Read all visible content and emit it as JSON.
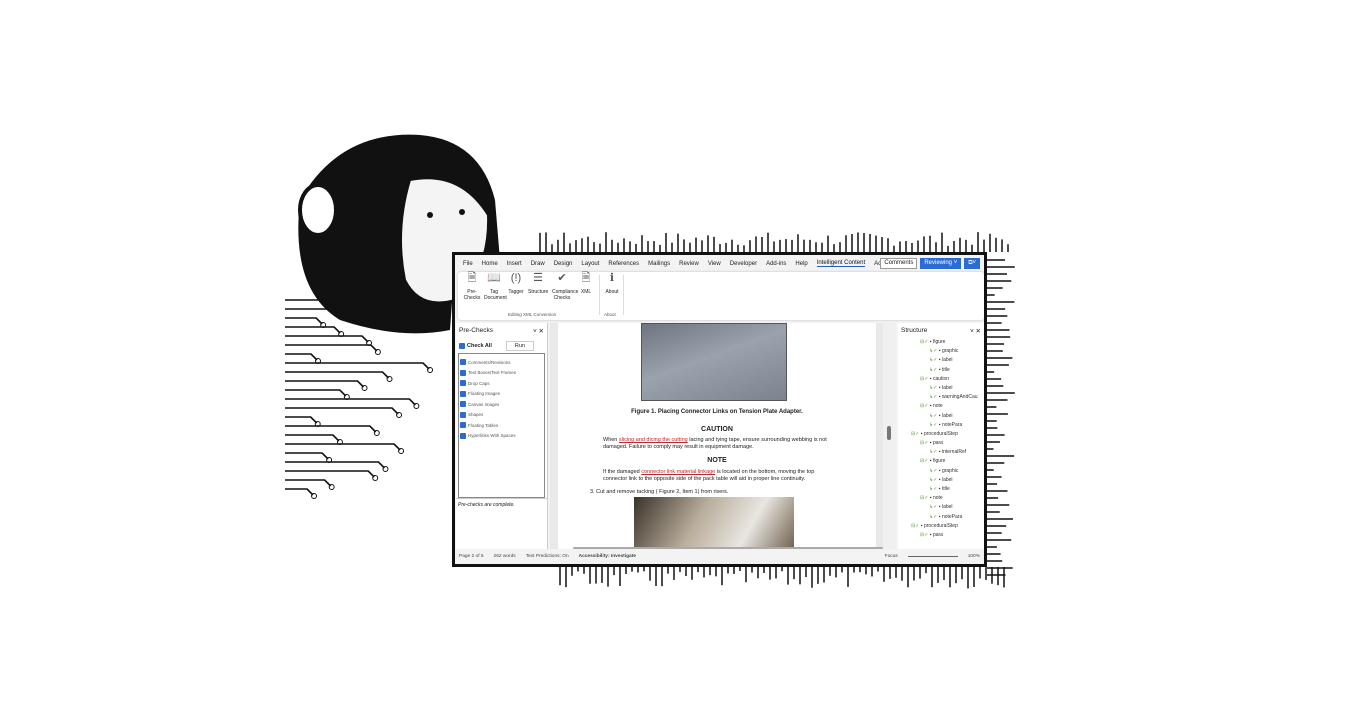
{
  "ribbon_tabs": [
    "File",
    "Home",
    "Insert",
    "Draw",
    "Design",
    "Layout",
    "References",
    "Mailings",
    "Review",
    "View",
    "Developer",
    "Add-ins",
    "Help",
    "Intelligent Content",
    "Acrobat"
  ],
  "active_tab": "Intelligent Content",
  "top_buttons": {
    "comments": "Comments",
    "reviewing": "Reviewing ˅",
    "share": "⧉˅"
  },
  "ribbon": {
    "buttons": [
      {
        "label": "Pre-Checks",
        "icon": "document-search-icon",
        "glyph": "🗎"
      },
      {
        "label": "Tag Document",
        "icon": "book-icon",
        "glyph": "📖"
      },
      {
        "label": "Tagger",
        "icon": "tag-icon",
        "glyph": "(!)"
      },
      {
        "label": "Structure",
        "icon": "structure-icon",
        "glyph": "☰"
      },
      {
        "label": "Compliance Checks",
        "icon": "checkmark-icon",
        "glyph": "✔"
      },
      {
        "label": "XML",
        "icon": "xml-icon",
        "glyph": "🗎"
      },
      {
        "label": "About",
        "icon": "info-icon",
        "glyph": "ℹ"
      }
    ],
    "groups": {
      "editing": "Editing XML Conversion",
      "about": "About"
    }
  },
  "prechecks": {
    "title": "Pre-Checks",
    "check_all": "Check All",
    "run": "Run",
    "items": [
      "Comments/Revisions",
      "Text Boxes/Text Frames",
      "Drop Caps",
      "Floating Images",
      "Canvas Images",
      "Shapes",
      "Floating Tables",
      "Hyperlinks With Spaces"
    ],
    "status": "Pre-checks are complete."
  },
  "document": {
    "figure_caption": "Figure 1.  Placing Connector Links on Tension Plate Adapter.",
    "caution_heading": "CAUTION",
    "caution_pre": "When ",
    "caution_link": "slicing and dicing the cutting",
    "caution_post": " lacing and tying tape, ensure surrounding webbing is not damaged.  Failure to comply may result in equipment damage.",
    "note_heading": "NOTE",
    "note_pre": "If the damaged ",
    "note_link": "connector link material linkage",
    "note_post": " is located on the bottom, moving the top connector link to the opposite side of the pack table will aid in proper line continuity.",
    "step": "3.  Cut and remove tacking ( Figure  2,  Item 1) from risers."
  },
  "structure": {
    "title": "Structure",
    "nodes": [
      {
        "label": "figure",
        "depth": 0
      },
      {
        "label": "graphic",
        "depth": 1
      },
      {
        "label": "label",
        "depth": 1
      },
      {
        "label": "title",
        "depth": 1
      },
      {
        "label": "caution",
        "depth": 0
      },
      {
        "label": "label",
        "depth": 1
      },
      {
        "label": "warningAndCau",
        "depth": 1
      },
      {
        "label": "note",
        "depth": 0
      },
      {
        "label": "label",
        "depth": 1
      },
      {
        "label": "notePara",
        "depth": 1
      },
      {
        "label": "proceduralStep",
        "depth": -1
      },
      {
        "label": "para",
        "depth": 0
      },
      {
        "label": "internalRef",
        "depth": 1
      },
      {
        "label": "figure",
        "depth": 0
      },
      {
        "label": "graphic",
        "depth": 1
      },
      {
        "label": "label",
        "depth": 1
      },
      {
        "label": "title",
        "depth": 1
      },
      {
        "label": "note",
        "depth": 0
      },
      {
        "label": "label",
        "depth": 1
      },
      {
        "label": "notePara",
        "depth": 1
      },
      {
        "label": "proceduralStep",
        "depth": -1
      },
      {
        "label": "para",
        "depth": 0
      }
    ]
  },
  "status_bar": {
    "page": "Page 2 of 5",
    "words": "262 words",
    "predictions": "Text Predictions: On",
    "accessibility": "Accessibility: Investigate",
    "focus": "Focus",
    "zoom": "100%"
  }
}
